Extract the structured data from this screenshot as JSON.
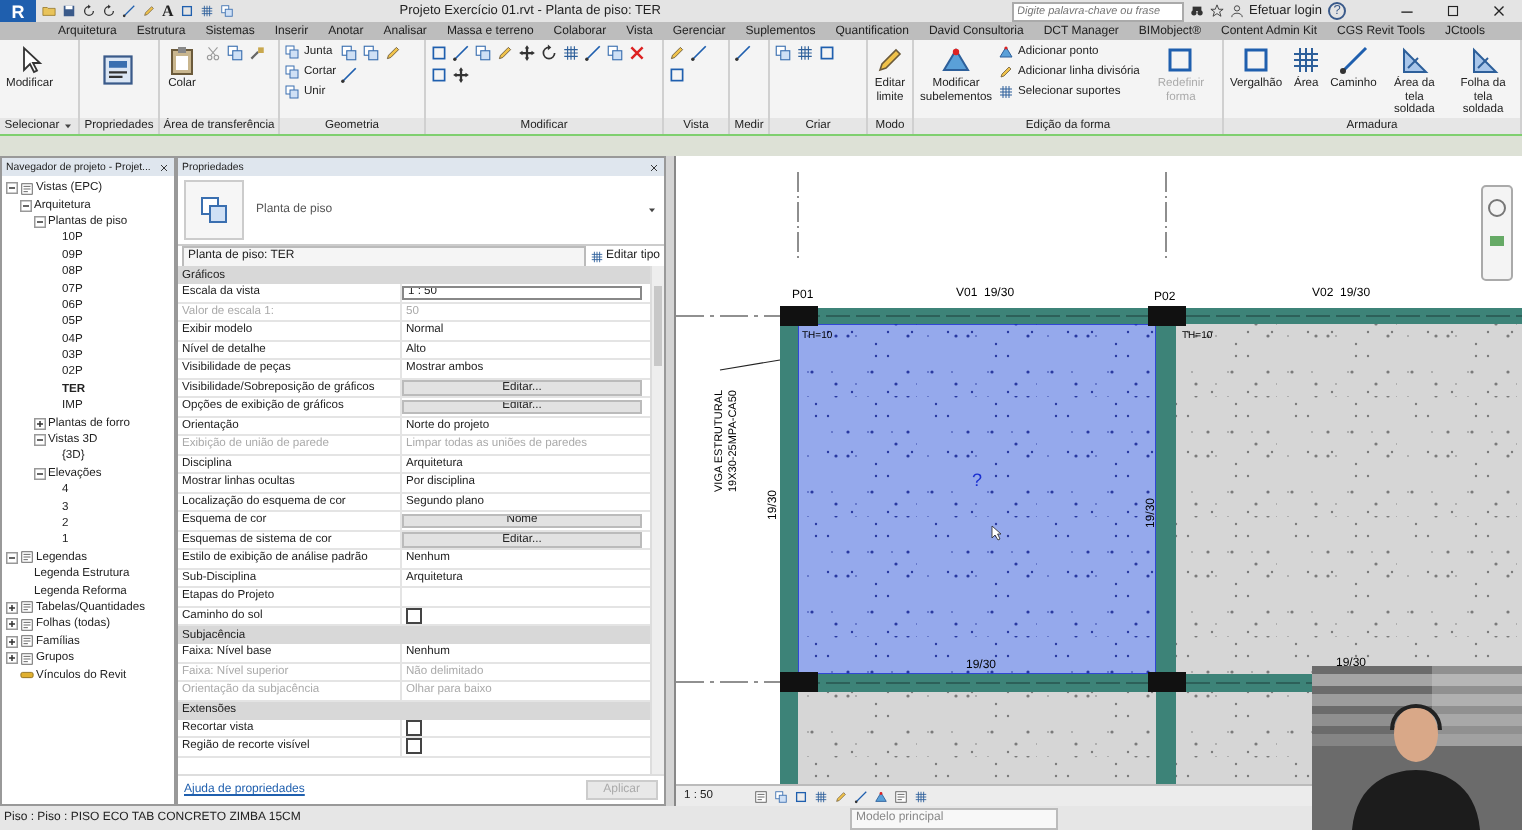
{
  "title_bar": {
    "logo": "R",
    "text_tool": "A",
    "title": "Projeto Exercício 01.rvt - Planta de piso: TER",
    "search": {
      "placeholder": "Digite palavra-chave ou frase"
    },
    "login": "Efetuar login",
    "help": "?"
  },
  "ribbon_tabs": [
    {
      "label": "Arquitetura"
    },
    {
      "label": "Estrutura"
    },
    {
      "label": "Sistemas"
    },
    {
      "label": "Inserir"
    },
    {
      "label": "Anotar"
    },
    {
      "label": "Analisar"
    },
    {
      "label": "Massa e terreno"
    },
    {
      "label": "Colaborar"
    },
    {
      "label": "Vista"
    },
    {
      "label": "Gerenciar"
    },
    {
      "label": "Suplementos"
    },
    {
      "label": "Quantification"
    },
    {
      "label": "David Consultoria"
    },
    {
      "label": "DCT Manager"
    },
    {
      "label": "BIMobject®"
    },
    {
      "label": "Content Admin Kit"
    },
    {
      "label": "CGS Revit Tools"
    },
    {
      "label": "JCtools"
    }
  ],
  "ribbon_panels": [
    {
      "label": "Selecionar",
      "dropdown": true,
      "buttons": [
        {
          "kind": "large",
          "label": "Modificar",
          "disabled": false
        }
      ]
    },
    {
      "label": "Propriedades"
    },
    {
      "label": "Área de transferência",
      "buttons": [
        {
          "kind": "large",
          "label": "Colar",
          "disabled": false
        }
      ]
    },
    {
      "label": "Geometria",
      "buttons": [
        {
          "kind": "small",
          "label": "Junta",
          "disabled": false
        },
        {
          "kind": "small",
          "label": "Cortar",
          "disabled": false
        },
        {
          "kind": "small",
          "label": "Unir",
          "disabled": false
        }
      ]
    },
    {
      "label": "Modificar"
    },
    {
      "label": "Vista"
    },
    {
      "label": "Medir"
    },
    {
      "label": "Criar"
    },
    {
      "label": "Modo",
      "buttons": [
        {
          "kind": "large",
          "label": "Editar limite",
          "disabled": false
        }
      ]
    },
    {
      "label": "Edição da forma",
      "buttons": [
        {
          "kind": "large",
          "label": "Modificar subelementos",
          "disabled": false
        },
        {
          "kind": "small",
          "label": "Adicionar ponto",
          "disabled": false
        },
        {
          "kind": "small",
          "label": "Adicionar linha divisória",
          "disabled": false
        },
        {
          "kind": "small",
          "label": "Selecionar suportes",
          "disabled": false
        },
        {
          "kind": "large",
          "label": "Redefinir forma",
          "disabled": true
        }
      ]
    },
    {
      "label": "Armadura",
      "buttons": [
        {
          "kind": "large",
          "label": "Vergalhão",
          "disabled": false
        },
        {
          "kind": "large",
          "label": "Área",
          "disabled": false
        },
        {
          "kind": "large",
          "label": "Caminho",
          "disabled": false
        },
        {
          "kind": "large",
          "label": "Área da tela soldada",
          "disabled": false
        },
        {
          "kind": "large",
          "label": "Folha da tela soldada",
          "disabled": false
        }
      ]
    }
  ],
  "browser": {
    "title": "Navegador de projeto - Projet...",
    "tree": [
      {
        "label": "Vistas (EPC)",
        "expanded": true,
        "selected": false,
        "children": [
          {
            "label": "Arquitetura",
            "expanded": true,
            "selected": false,
            "children": [
              {
                "label": "Plantas de piso",
                "expanded": true,
                "selected": false,
                "children": [
                  {
                    "label": "10P",
                    "selected": false
                  },
                  {
                    "label": "09P",
                    "selected": false
                  },
                  {
                    "label": "08P",
                    "selected": false
                  },
                  {
                    "label": "07P",
                    "selected": false
                  },
                  {
                    "label": "06P",
                    "selected": false
                  },
                  {
                    "label": "05P",
                    "selected": false
                  },
                  {
                    "label": "04P",
                    "selected": false
                  },
                  {
                    "label": "03P",
                    "selected": false
                  },
                  {
                    "label": "02P",
                    "selected": false
                  },
                  {
                    "label": "TER",
                    "selected": true
                  },
                  {
                    "label": "IMP",
                    "selected": false
                  }
                ]
              },
              {
                "label": "Plantas de forro",
                "expanded": false,
                "selected": false
              },
              {
                "label": "Vistas 3D",
                "expanded": true,
                "selected": false,
                "children": [
                  {
                    "label": "{3D}",
                    "selected": false
                  }
                ]
              },
              {
                "label": "Elevações",
                "expanded": true,
                "selected": false,
                "children": [
                  {
                    "label": "4",
                    "selected": false
                  },
                  {
                    "label": "3",
                    "selected": false
                  },
                  {
                    "label": "2",
                    "selected": false
                  },
                  {
                    "label": "1",
                    "selected": false
                  }
                ]
              }
            ]
          }
        ]
      },
      {
        "label": "Legendas",
        "expanded": true,
        "selected": false,
        "children": [
          {
            "label": "Legenda Estrutura",
            "selected": false
          },
          {
            "label": "Legenda Reforma",
            "selected": false
          }
        ]
      },
      {
        "label": "Tabelas/Quantidades",
        "expanded": false,
        "selected": false
      },
      {
        "label": "Folhas (todas)",
        "expanded": false,
        "selected": false
      },
      {
        "label": "Famílias",
        "expanded": false,
        "selected": false
      },
      {
        "label": "Grupos",
        "expanded": false,
        "selected": false
      },
      {
        "label": "Vínculos do Revit",
        "selected": false
      }
    ]
  },
  "properties": {
    "title": "Propriedades",
    "type_name": "Planta de piso",
    "instance": "Planta de piso: TER",
    "edit_type": "Editar tipo",
    "groups": [
      {
        "label": "Gráficos",
        "rows": [
          {
            "kind": "field",
            "name": "Escala da vista",
            "value": "1 : 50",
            "disabled": false
          },
          {
            "kind": "text",
            "name": "Valor de escala    1:",
            "value": "50",
            "disabled": true
          },
          {
            "kind": "text",
            "name": "Exibir modelo",
            "value": "Normal",
            "disabled": false
          },
          {
            "kind": "text",
            "name": "Nível de detalhe",
            "value": "Alto",
            "disabled": false
          },
          {
            "kind": "text",
            "name": "Visibilidade de peças",
            "value": "Mostrar ambos",
            "disabled": false
          },
          {
            "kind": "button",
            "name": "Visibilidade/Sobreposição de gráficos",
            "value": "Editar...",
            "disabled": false
          },
          {
            "kind": "button",
            "name": "Opções de exibição de gráficos",
            "value": "Editar...",
            "disabled": false
          },
          {
            "kind": "text",
            "name": "Orientação",
            "value": "Norte do projeto",
            "disabled": false
          },
          {
            "kind": "text",
            "name": "Exibição de união de parede",
            "value": "Limpar todas as uniões de paredes",
            "disabled": true
          },
          {
            "kind": "text",
            "name": "Disciplina",
            "value": "Arquitetura",
            "disabled": false
          },
          {
            "kind": "text",
            "name": "Mostrar linhas ocultas",
            "value": "Por disciplina",
            "disabled": false
          },
          {
            "kind": "text",
            "name": "Localização do esquema de cor",
            "value": "Segundo plano",
            "disabled": false
          },
          {
            "kind": "button",
            "name": "Esquema de cor",
            "value": "Nome",
            "disabled": false
          },
          {
            "kind": "button",
            "name": "Esquemas de sistema de cor",
            "value": "Editar...",
            "disabled": false
          },
          {
            "kind": "text",
            "name": "Estilo de exibição de análise padrão",
            "value": "Nenhum",
            "disabled": false
          },
          {
            "kind": "text",
            "name": "Sub-Disciplina",
            "value": "Arquitetura",
            "disabled": false
          },
          {
            "kind": "text",
            "name": "Etapas do Projeto",
            "disabled": false
          },
          {
            "kind": "checkbox",
            "name": "Caminho do sol",
            "checked": false,
            "disabled": false
          }
        ]
      },
      {
        "label": "Subjacência",
        "rows": [
          {
            "kind": "text",
            "name": "Faixa: Nível base",
            "value": "Nenhum",
            "disabled": false
          },
          {
            "kind": "text",
            "name": "Faixa: Nível superior",
            "value": "Não delimitado",
            "disabled": true
          },
          {
            "kind": "text",
            "name": "Orientação da subjacência",
            "value": "Olhar para baixo",
            "disabled": true
          }
        ]
      },
      {
        "label": "Extensões",
        "rows": [
          {
            "kind": "checkbox",
            "name": "Recortar vista",
            "checked": false,
            "disabled": false
          },
          {
            "kind": "checkbox",
            "name": "Região de recorte visível",
            "checked": false,
            "disabled": false
          }
        ]
      }
    ],
    "help_link": "Ajuda de propriedades",
    "apply": {
      "label": "Aplicar",
      "disabled": true
    }
  },
  "plan": {
    "columns": [
      {
        "label": "P01"
      },
      {
        "label": "P02"
      }
    ],
    "beams": [
      {
        "label": "V01  19/30"
      },
      {
        "label": "V02  19/30"
      }
    ],
    "thickness_labels": [
      "TH=10",
      "TH=10"
    ],
    "dimension_labels": [
      "19/30",
      "19/30",
      "19/30",
      "19/30"
    ],
    "beam_tag": [
      "VIGA ESTRUTURAL",
      "19X30-25MPA-CA50"
    ],
    "room_tag": "?",
    "slabs": [
      {
        "selected": true
      },
      {
        "selected": false
      },
      {
        "selected": false
      },
      {
        "selected": false
      }
    ]
  },
  "view_bar": {
    "scale": "1 : 50"
  },
  "status_bar": {
    "text": "Piso : Piso : PISO ECO TAB CONCRETO ZIMBA 15CM",
    "model": "Modelo principal"
  }
}
